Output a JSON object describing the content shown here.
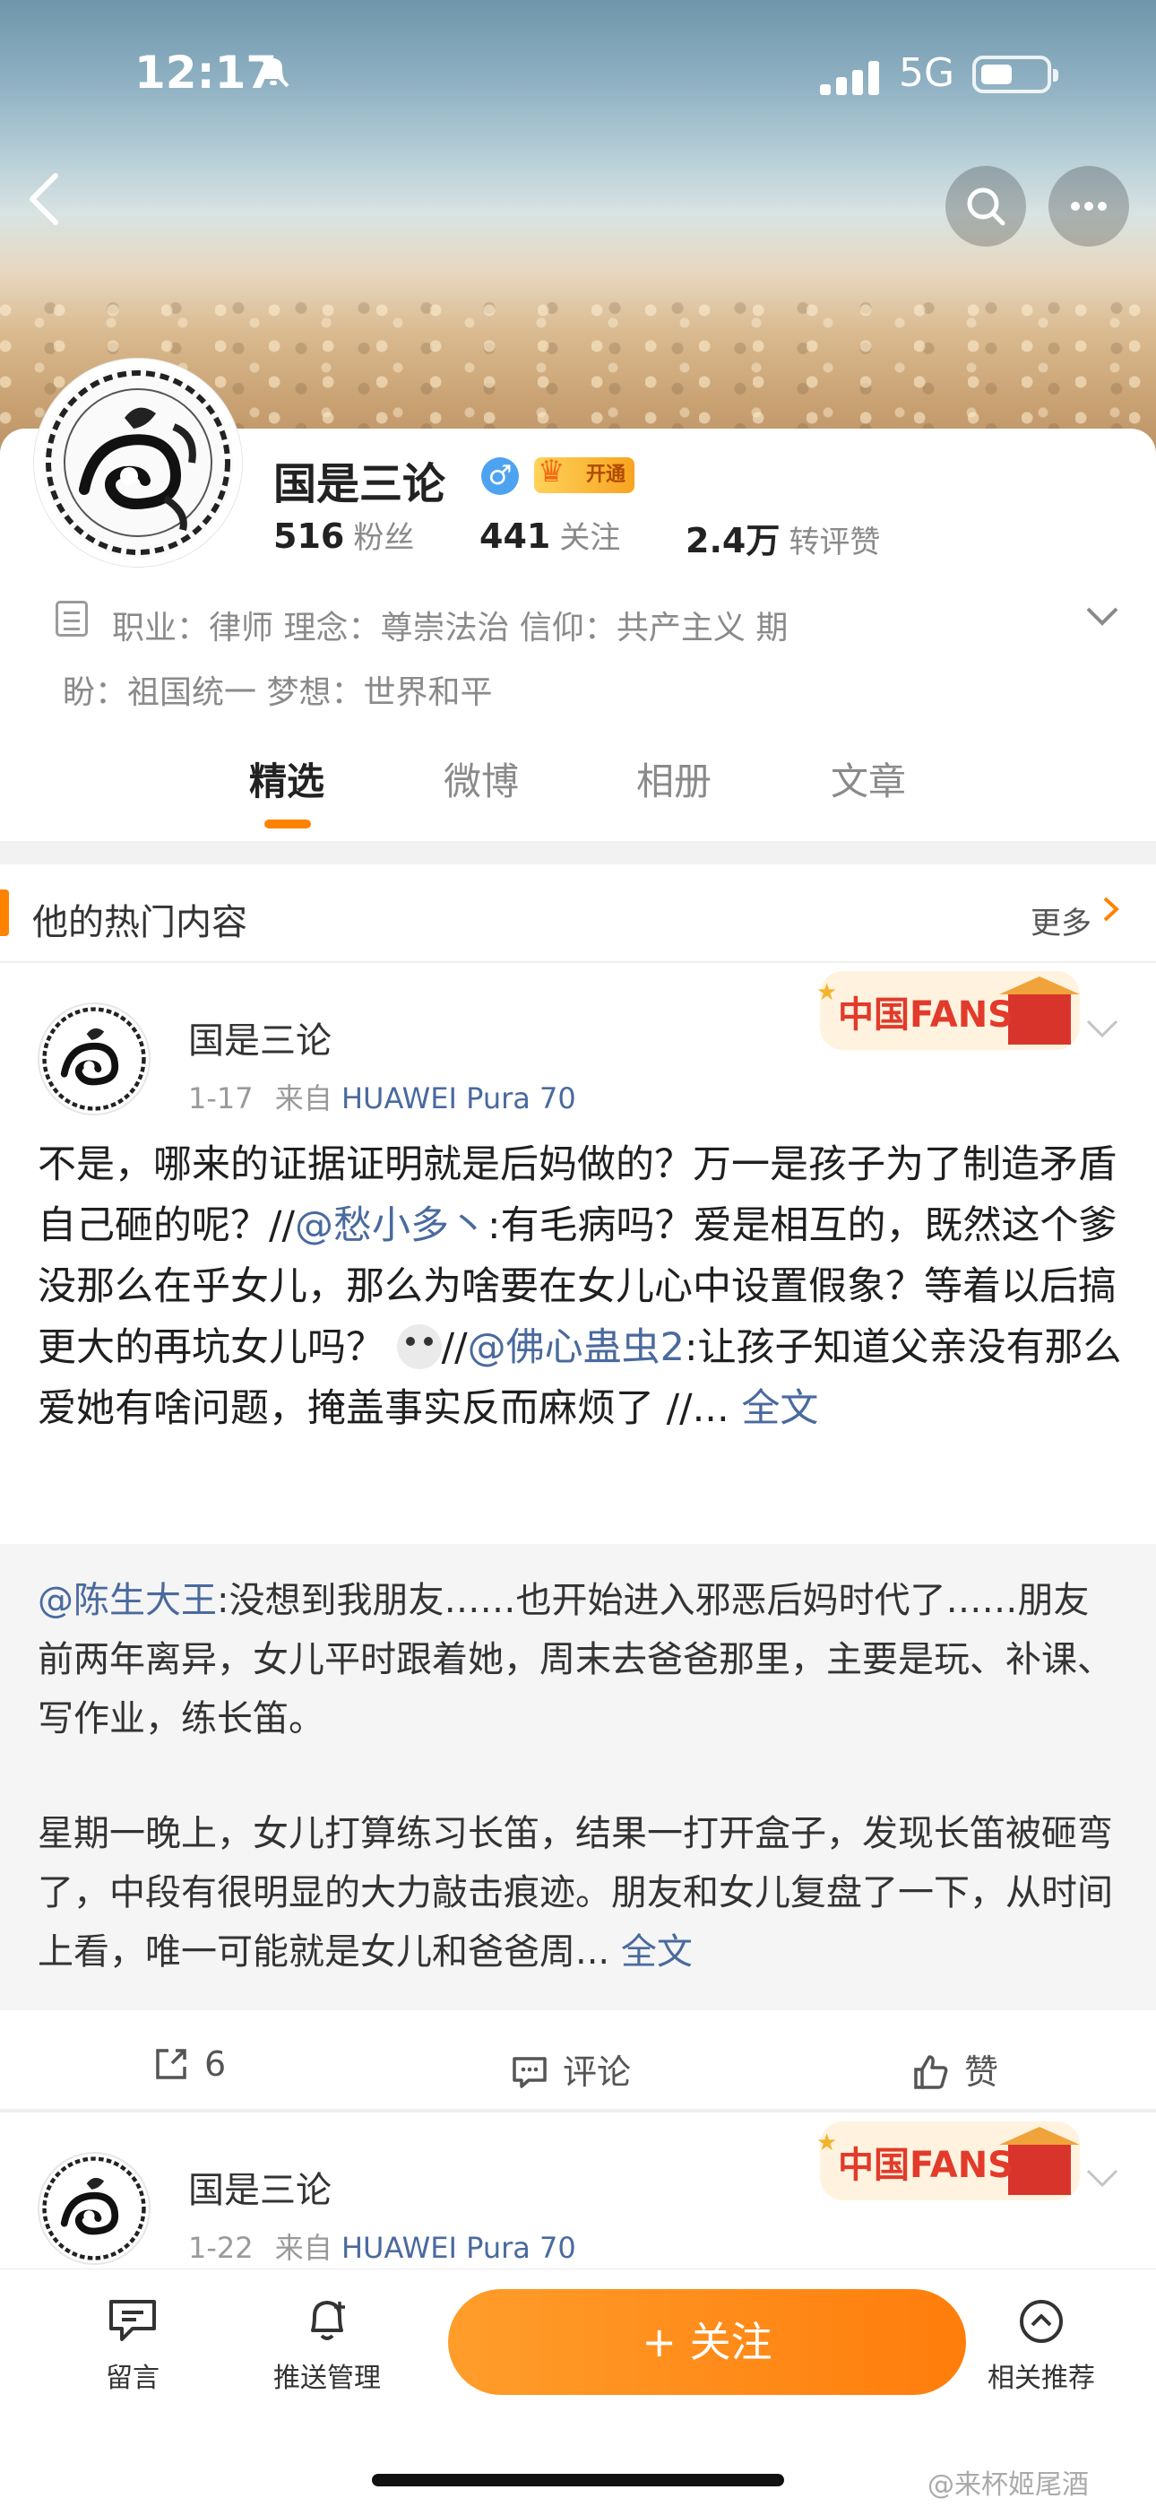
{
  "status_bar": {
    "time": "12:17",
    "network": "5G"
  },
  "profile": {
    "name": "国是三论",
    "gender_symbol": "♂",
    "vip_label": "开通",
    "stats": [
      {
        "value": "516",
        "label": "粉丝"
      },
      {
        "value": "441",
        "label": "关注"
      },
      {
        "value": "2.4万",
        "label": "转评赞"
      }
    ],
    "bio_line1": "职业：律师   理念：尊崇法治   信仰：共产主义   期",
    "bio_line2": "盼：祖国统一   梦想：世界和平"
  },
  "tabs": [
    "精选",
    "微博",
    "相册",
    "文章"
  ],
  "hot_section": {
    "title": "他的热门内容",
    "more": "更多"
  },
  "posts": [
    {
      "author": "国是三论",
      "date": "1-17",
      "source_prefix": "来自",
      "device": "HUAWEI Pura 70",
      "badge": "中国FANS",
      "text_a": "不是，哪来的证据证明就是后妈做的？万一是孩子为了制造矛盾自己砸的呢？//",
      "mention1": "@愁小多丶",
      "text_b": ":有毛病吗？爱是相互的，既然这个爹没那么在乎女儿，那么为啥要在女儿心中设置假象？等着以后搞更大的再坑女儿吗？",
      "text_c": "//",
      "mention2": "@佛心蛊虫2",
      "text_d": ":让孩子知道父亲没有那么爱她有啥问题，掩盖事实反而麻烦了 //...",
      "full_text": "全文",
      "repost_mention": "@陈生大王",
      "repost_p1": ":没想到我朋友……也开始进入邪恶后妈时代了……朋友前两年离异，女儿平时跟着她，周末去爸爸那里，主要是玩、补课、写作业，练长笛。",
      "repost_p2": "星期一晚上，女儿打算练习长笛，结果一打开盒子，发现长笛被砸弯了，中段有很明显的大力敲击痕迹。朋友和女儿复盘了一下，从时间上看，唯一可能就是女儿和爸爸周...",
      "repost_full": "全文",
      "repost_count": "6",
      "comment_label": "评论",
      "like_label": "赞"
    },
    {
      "author": "国是三论",
      "date": "1-22",
      "source_prefix": "来自",
      "device": "HUAWEI Pura 70",
      "badge": "中国FANS"
    }
  ],
  "bottom_bar": {
    "message": "留言",
    "push": "推送管理",
    "follow": "+ 关注",
    "related": "相关推荐"
  },
  "watermark": "@来杯姬尾酒",
  "colors": {
    "accent": "#ff8200",
    "link": "#4a6a9e",
    "vip_gold": "#f7a420"
  }
}
